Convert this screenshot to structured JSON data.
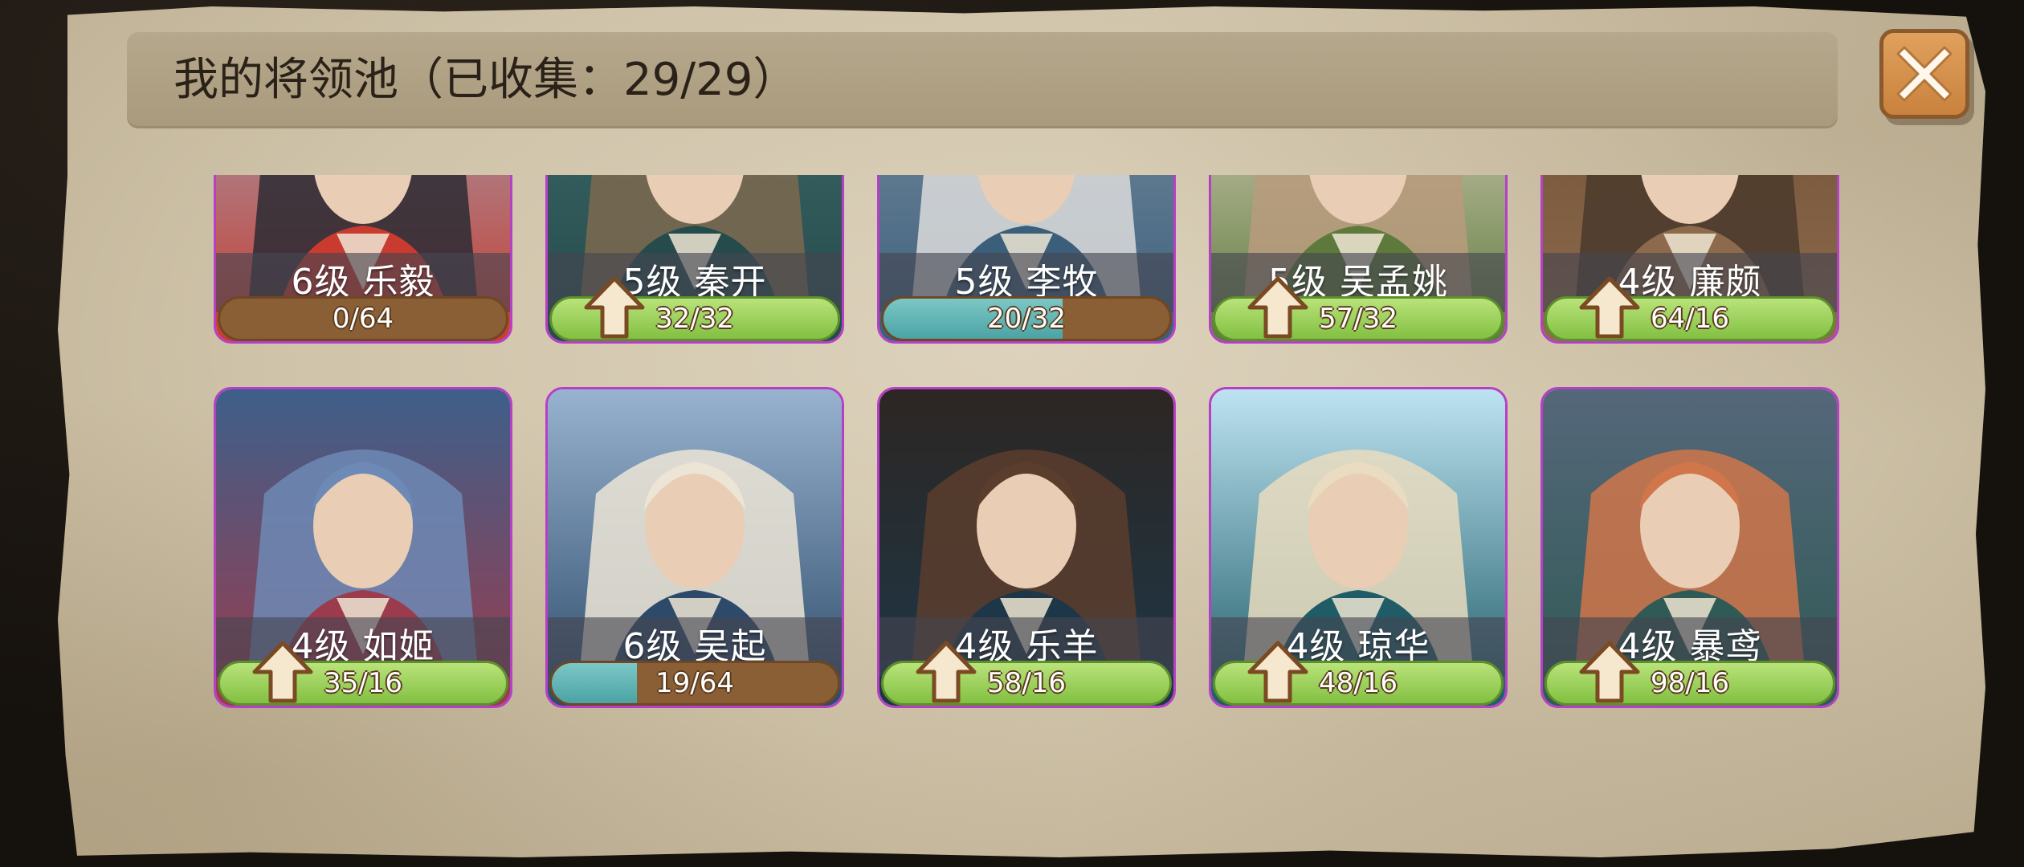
{
  "dialog": {
    "title": "我的将领池（已收集：29/29）"
  },
  "close_icon": "close-x-icon",
  "generals": [
    {
      "level_name": "6级  乐毅",
      "count": "0/64",
      "progress": 0.0,
      "upgradable": false,
      "palette": [
        "#9aa9bc",
        "#c93b2f",
        "#2c2c34"
      ]
    },
    {
      "level_name": "5级  秦开",
      "count": "32/32",
      "progress": 1.0,
      "upgradable": true,
      "palette": [
        "#3f6a6a",
        "#254b4c",
        "#7c6a50"
      ]
    },
    {
      "level_name": "5级  李牧",
      "count": "20/32",
      "progress": 0.625,
      "upgradable": false,
      "palette": [
        "#7c8fa3",
        "#3b5f7a",
        "#dcdcdc"
      ]
    },
    {
      "level_name": "5级 吴孟姚",
      "count": "57/32",
      "progress": 1.0,
      "upgradable": true,
      "palette": [
        "#e3d8c6",
        "#5d7a3c",
        "#b89b7c"
      ]
    },
    {
      "level_name": "4级  廉颇",
      "count": "64/16",
      "progress": 1.0,
      "upgradable": true,
      "palette": [
        "#6e4f36",
        "#8c6a4b",
        "#4a3a2c"
      ]
    },
    {
      "level_name": "4级  如姬",
      "count": "35/16",
      "progress": 1.0,
      "upgradable": true,
      "palette": [
        "#3d5f8a",
        "#9b3b4c",
        "#6d89b5"
      ]
    },
    {
      "level_name": "6级  吴起",
      "count": "19/64",
      "progress": 0.297,
      "upgradable": false,
      "palette": [
        "#97b3cf",
        "#2d4a6a",
        "#ece5d6"
      ]
    },
    {
      "level_name": "4级  乐羊",
      "count": "58/16",
      "progress": 1.0,
      "upgradable": true,
      "palette": [
        "#2d2623",
        "#1d3748",
        "#5a3d2d"
      ]
    },
    {
      "level_name": "4级  琼华",
      "count": "48/16",
      "progress": 1.0,
      "upgradable": true,
      "palette": [
        "#bde3f2",
        "#1f5c67",
        "#e9dcc0"
      ]
    },
    {
      "level_name": "4级  暴鸢",
      "count": "98/16",
      "progress": 1.0,
      "upgradable": true,
      "palette": [
        "#55677a",
        "#2f5a55",
        "#d0764a"
      ]
    }
  ]
}
